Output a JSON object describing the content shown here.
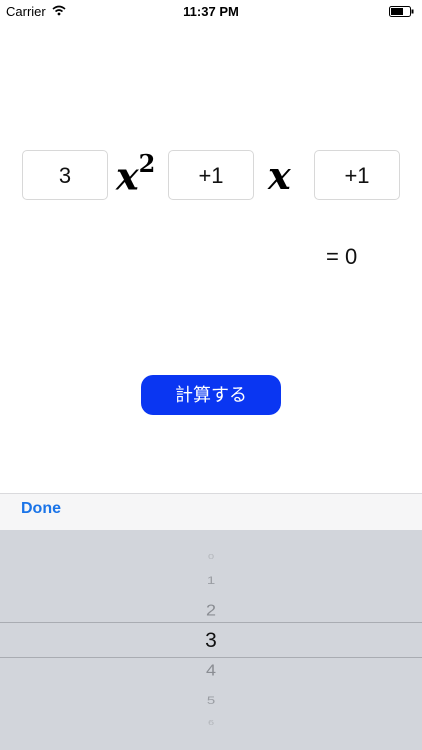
{
  "status_bar": {
    "carrier": "Carrier",
    "time": "11:37 PM"
  },
  "equation": {
    "coef_a": "3",
    "x_squared_symbol": "x",
    "exponent": "2",
    "coef_b": "+1",
    "x_symbol": "x",
    "coef_c": "+1",
    "result": "= 0"
  },
  "calc_button": {
    "label": "計算する"
  },
  "toolbar": {
    "done_label": "Done"
  },
  "picker": {
    "values": [
      "0",
      "1",
      "2",
      "3",
      "4",
      "5",
      "6"
    ],
    "selected": "3"
  },
  "colors": {
    "accent": "#0a36f2",
    "done": "#1a74e8",
    "picker_bg": "#d2d5db",
    "toolbar_bg": "#f6f6f7"
  }
}
